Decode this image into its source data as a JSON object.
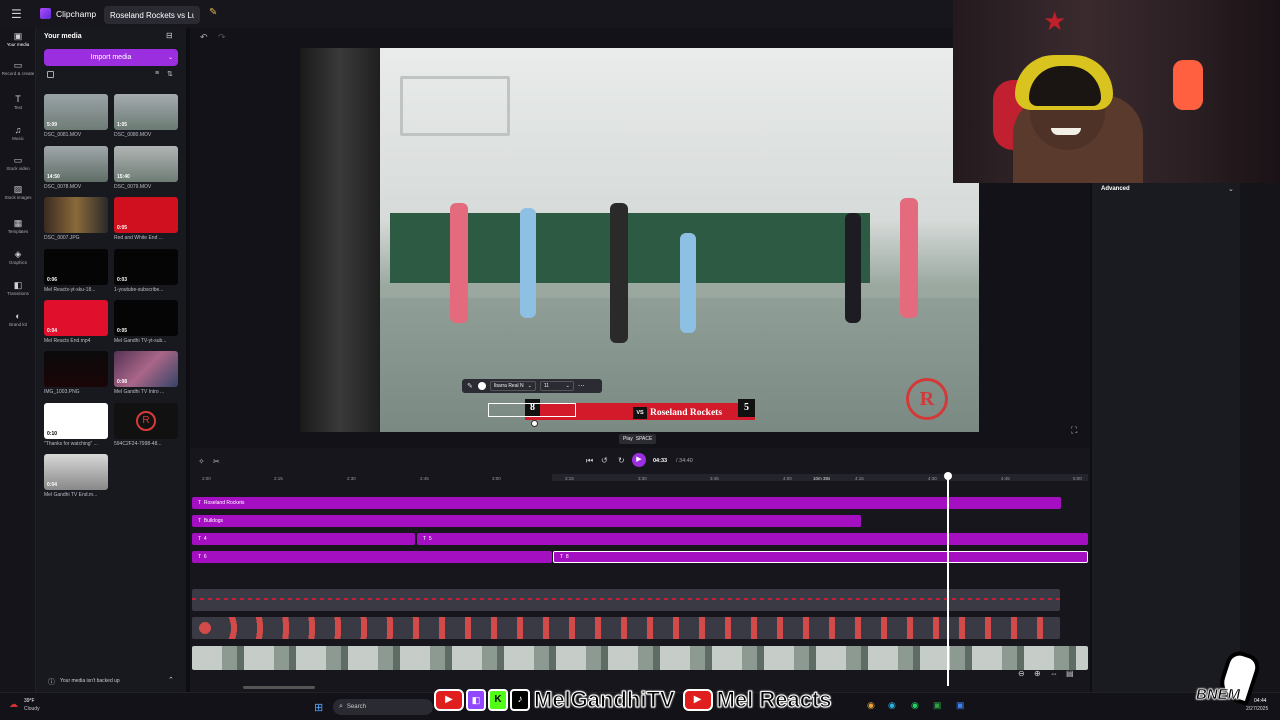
{
  "titlebar": {
    "app_name": "Clipchamp",
    "project_tab": "Roseland Rockets vs Lucky L"
  },
  "rail": {
    "items": [
      {
        "label": "Your media",
        "icon": "media-icon"
      },
      {
        "label": "Record & create",
        "icon": "record-icon"
      },
      {
        "label": "Text",
        "icon": "text-icon"
      },
      {
        "label": "Music",
        "icon": "music-icon"
      },
      {
        "label": "Stock video",
        "icon": "stock-video-icon"
      },
      {
        "label": "Stock images",
        "icon": "stock-images-icon"
      },
      {
        "label": "Templates",
        "icon": "templates-icon"
      },
      {
        "label": "Graphics",
        "icon": "graphics-icon"
      },
      {
        "label": "Transitions",
        "icon": "transitions-icon"
      },
      {
        "label": "Brand kit",
        "icon": "brand-kit-icon"
      }
    ]
  },
  "media": {
    "title": "Your media",
    "import_label": "Import media",
    "backup_notice": "Your media isn't backed up",
    "items": [
      {
        "name": "DSC_0081.MOV",
        "duration": "5:09"
      },
      {
        "name": "DSC_0080.MOV",
        "duration": "1:05"
      },
      {
        "name": "DSC_0078.MOV",
        "duration": "14:50"
      },
      {
        "name": "DSC_0079.MOV",
        "duration": "15:40"
      },
      {
        "name": "DSC_0007.JPG",
        "duration": ""
      },
      {
        "name": "Red and White End ...",
        "duration": "0:05"
      },
      {
        "name": "Mel Reacts-yt-sku-18...",
        "duration": "0:06"
      },
      {
        "name": "1-youtube-subscribe...",
        "duration": "0:03"
      },
      {
        "name": "Mel Reacts End.mp4",
        "duration": "0:04"
      },
      {
        "name": "Mel Gandhi TV-yt-sub...",
        "duration": "0:05"
      },
      {
        "name": "IMG_1003.PNG",
        "duration": ""
      },
      {
        "name": "Mel Gandhi TV Intro ...",
        "duration": "0:08"
      },
      {
        "name": "\"Thanks for watching\" ...",
        "duration": "0:10"
      },
      {
        "name": "594C2F24-7998-48...",
        "duration": ""
      },
      {
        "name": "Mel Gandhi TV End.m...",
        "duration": "0:04"
      }
    ]
  },
  "text_toolbar": {
    "font": "Ibarra Real N",
    "size": "11"
  },
  "scoreboard": {
    "home_score": "8",
    "vs": "VS",
    "team": "Roseland Rockets",
    "away_score": "5"
  },
  "playback": {
    "tooltip_label": "Play",
    "tooltip_key": "SPACE",
    "current_time": "04:33",
    "total_time": "/ 34:40"
  },
  "props": {
    "advanced_label": "Advanced"
  },
  "timeline": {
    "ruler": [
      "2:00",
      "2:15",
      "2:30",
      "2:45",
      "3:00",
      "3:15",
      "3:30",
      "3:45",
      "4:00",
      "4:15",
      "4:30",
      "4:45",
      "5:00"
    ],
    "ruler_note": "10m 38s",
    "tracks": {
      "t1": "Roseland Rockets",
      "t2": "Bulldogs",
      "t3a": "4",
      "t3b": "5",
      "t4a": "6",
      "t4b": "8"
    }
  },
  "taskbar": {
    "weather_temp": "39°F",
    "weather_desc": "Cloudy",
    "search": "Search",
    "time": "04:44",
    "date": "2/27/2025"
  },
  "overlay": {
    "channel1": "MelGandhiTV",
    "channel2": "Mel Reacts",
    "logo": "BNEM"
  }
}
